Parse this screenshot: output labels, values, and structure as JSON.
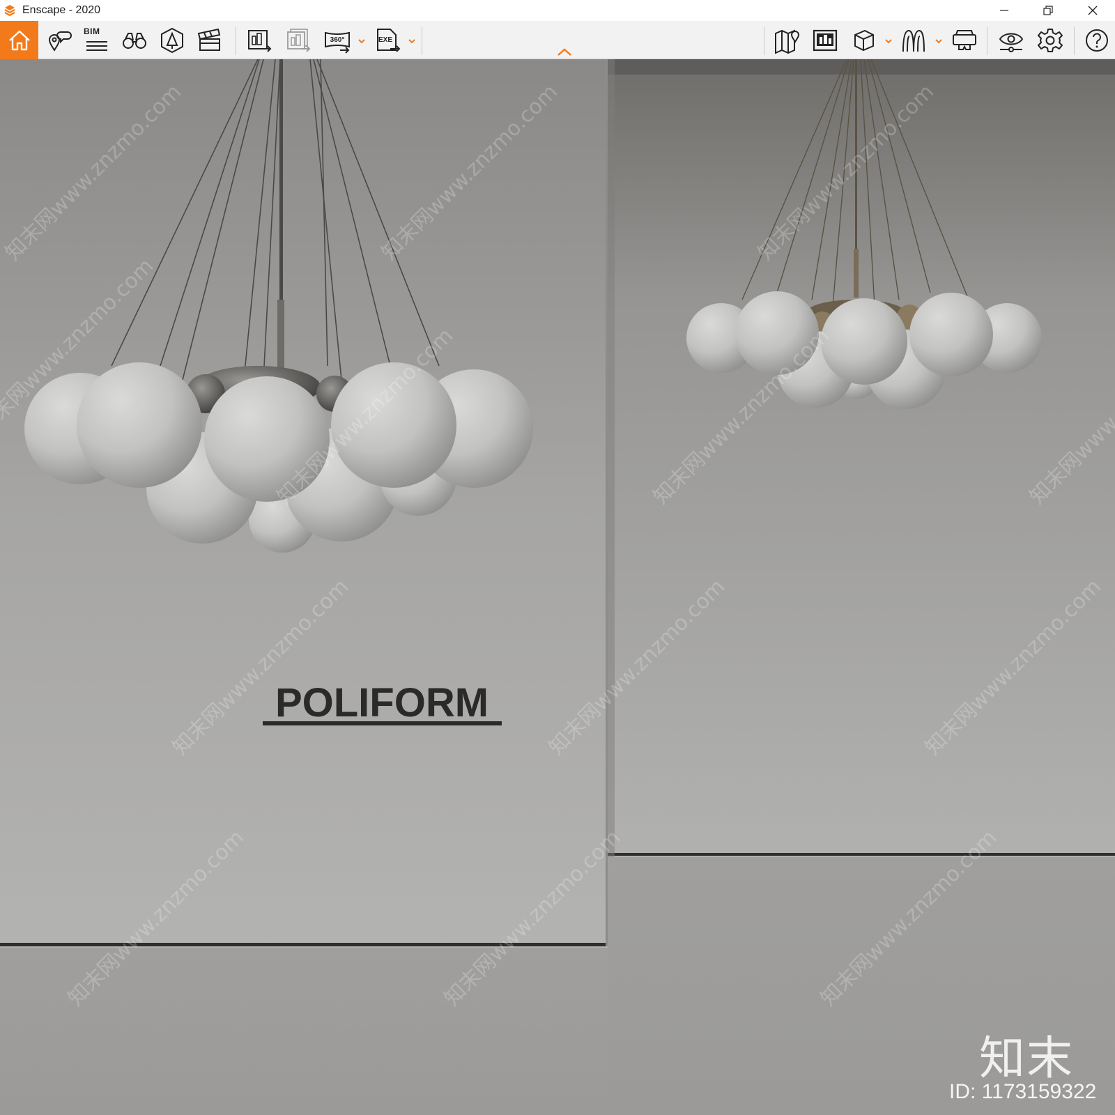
{
  "window": {
    "title": "Enscape - 2020",
    "minimize_icon": "minimize-icon",
    "maximize_icon": "restore-icon",
    "close_icon": "close-icon"
  },
  "toolbar": {
    "accent_color": "#f27a1a",
    "left_tools": [
      {
        "icon": "home-icon"
      },
      {
        "icon": "view-management-icon"
      },
      {
        "icon": "bim-icon",
        "label": "BIM"
      },
      {
        "icon": "binoculars-icon"
      },
      {
        "icon": "asset-library-icon"
      },
      {
        "icon": "clapperboard-icon"
      },
      {
        "icon": "render-image-icon"
      },
      {
        "icon": "batch-render-icon"
      },
      {
        "icon": "panorama-360-icon"
      },
      {
        "icon": "export-exe-icon"
      }
    ],
    "right_tools": [
      {
        "icon": "map-icon"
      },
      {
        "icon": "minimap-icon"
      },
      {
        "icon": "cube-icon"
      },
      {
        "icon": "walkthrough-icon"
      },
      {
        "icon": "vr-headset-icon"
      },
      {
        "icon": "visual-settings-icon"
      },
      {
        "icon": "gear-icon"
      },
      {
        "icon": "help-icon"
      }
    ],
    "collapse_icon": "chevron-up-icon"
  },
  "viewport": {
    "logo_text": "POLIFORM",
    "watermark_text": "知末网www.znzmo.com",
    "corner_logo": "知末",
    "image_id": "ID: 1173159322",
    "wall_color": "#a8a8a6",
    "floor_color": "#9c9c9a"
  }
}
